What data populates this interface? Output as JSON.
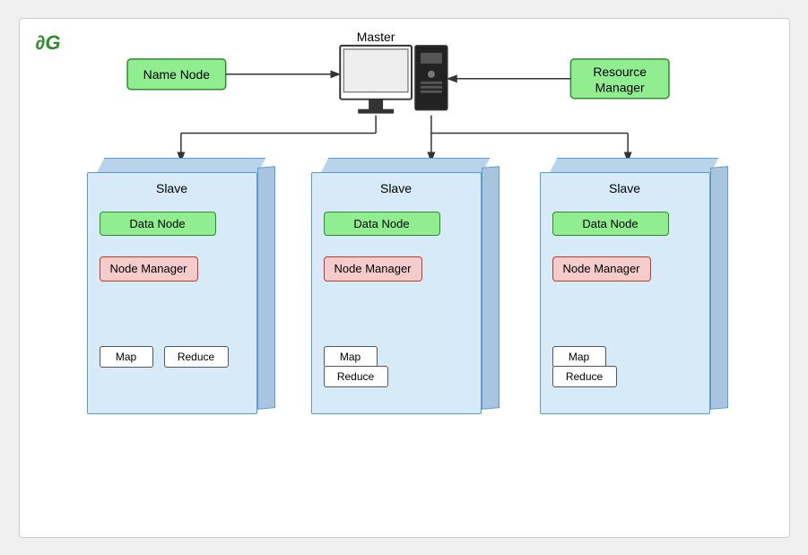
{
  "logo": "∂G",
  "master": {
    "label": "Master",
    "name_node": "Name Node",
    "resource_manager": "Resource\nManager"
  },
  "slaves": [
    {
      "label": "Slave",
      "data_node": "Data Node",
      "node_manager": "Node\nManager",
      "map": "Map",
      "reduce": "Reduce"
    },
    {
      "label": "Slave",
      "data_node": "Data Node",
      "node_manager": "Node\nManager",
      "map": "Map",
      "reduce": "Reduce"
    },
    {
      "label": "Slave",
      "data_node": "Data Node",
      "node_manager": "Node\nManager",
      "map": "Map",
      "reduce": "Reduce"
    }
  ],
  "colors": {
    "green_box": "#90ee90",
    "green_border": "#2e8b2e",
    "red_box": "#f4cccc",
    "red_border": "#c0392b",
    "blue_cube": "#d6eaf8",
    "blue_border": "#5b9bd5"
  }
}
